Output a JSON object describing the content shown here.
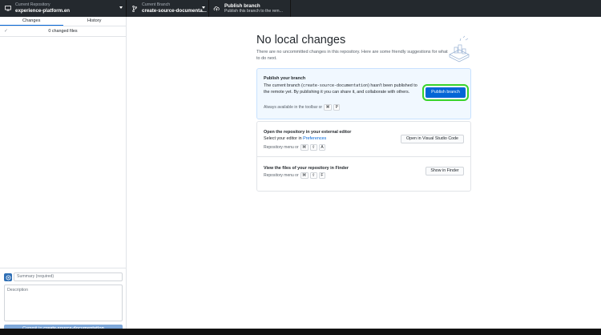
{
  "toolbar": {
    "repo": {
      "label": "Current Repository",
      "value": "experience-platform.en"
    },
    "branch": {
      "label": "Current Branch",
      "value": "create-source-documenta..."
    },
    "publish": {
      "label": "Publish branch",
      "value": "Publish this branch to the rem..."
    }
  },
  "sidebar": {
    "tabs": [
      "Changes",
      "History"
    ],
    "changed_files": "0 changed files",
    "summary_placeholder": "Summary (required)",
    "description_placeholder": "Description",
    "commit_prefix": "Commit to ",
    "commit_branch": "create-source-documentation"
  },
  "main": {
    "title": "No local changes",
    "subtitle": "There are no uncommitted changes in this repository. Here are some friendly suggestions for what to do next.",
    "publish_card": {
      "title": "Publish your branch",
      "text_1": "The current branch (",
      "branch": "create-source-documentation",
      "text_2": ") hasn't been published to the remote yet. By publishing it you can share it, and collaborate with others.",
      "hint": "Always available in the toolbar or",
      "keys": [
        "⌘",
        "P"
      ],
      "button": "Publish branch"
    },
    "editor_card": {
      "title": "Open the repository in your external editor",
      "text": "Select your editor in ",
      "link": "Preferences",
      "hint": "Repository menu or",
      "keys": [
        "⌘",
        "⇧",
        "A"
      ],
      "button": "Open in Visual Studio Code"
    },
    "finder_card": {
      "title": "View the files of your repository in Finder",
      "hint": "Repository menu or",
      "keys": [
        "⌘",
        "⇧",
        "F"
      ],
      "button": "Show in Finder"
    }
  },
  "colors": {
    "toolbar_bg": "#24292e",
    "primary": "#0366d6",
    "highlight": "#39d32b"
  }
}
